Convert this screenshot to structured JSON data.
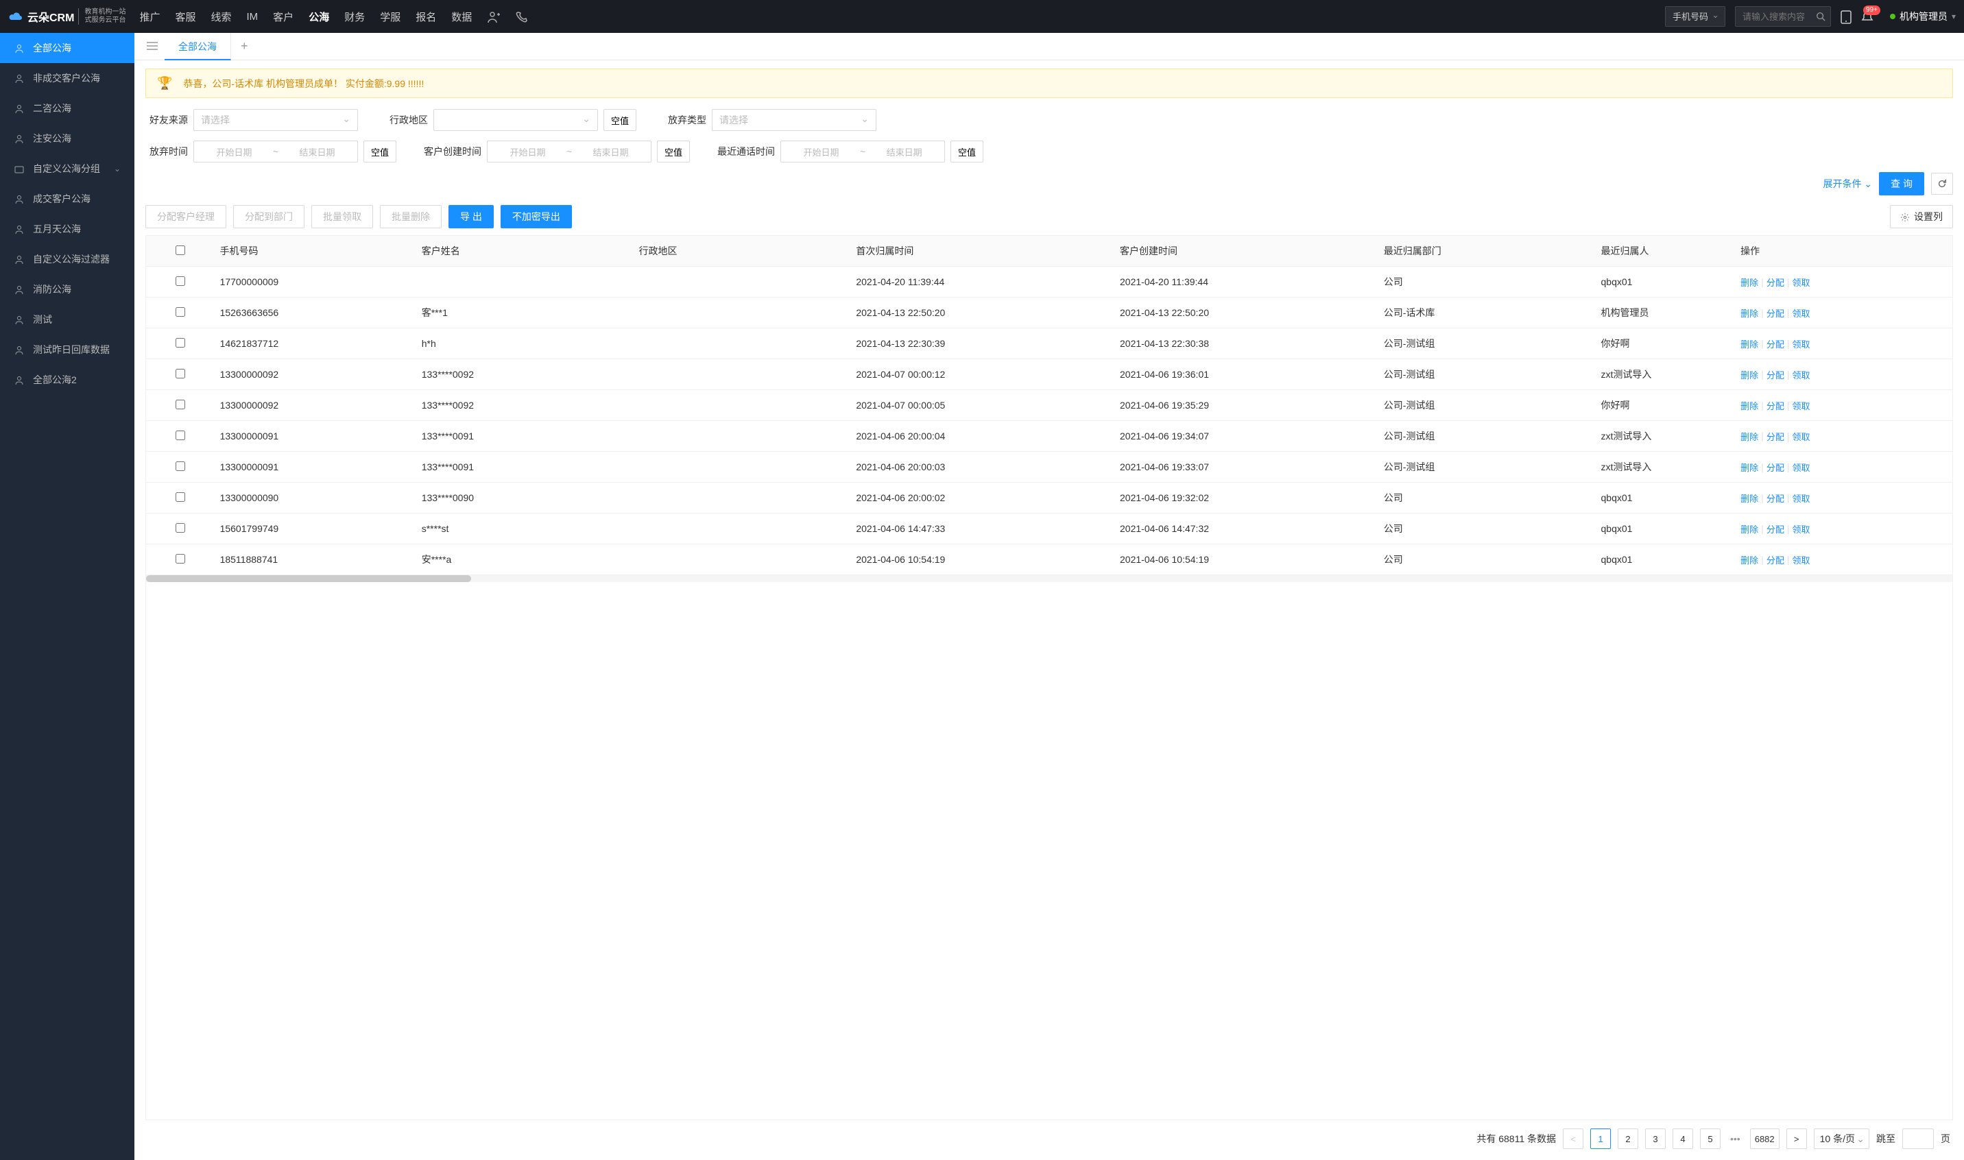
{
  "header": {
    "logo_main": "云朵CRM",
    "logo_sub_line1": "教育机构一站",
    "logo_sub_line2": "式服务云平台",
    "logo_url": "www.yunduocrm.com",
    "nav": [
      "推广",
      "客服",
      "线索",
      "IM",
      "客户",
      "公海",
      "财务",
      "学服",
      "报名",
      "数据"
    ],
    "nav_active_index": 5,
    "search_type": "手机号码",
    "search_placeholder": "请输入搜索内容",
    "badge": "99+",
    "user_name": "机构管理员"
  },
  "sidebar": {
    "items": [
      {
        "label": "全部公海",
        "icon": "users"
      },
      {
        "label": "非成交客户公海",
        "icon": "users"
      },
      {
        "label": "二咨公海",
        "icon": "users"
      },
      {
        "label": "注安公海",
        "icon": "users"
      },
      {
        "label": "自定义公海分组",
        "icon": "folder",
        "expandable": true
      },
      {
        "label": "成交客户公海",
        "icon": "users"
      },
      {
        "label": "五月天公海",
        "icon": "users"
      },
      {
        "label": "自定义公海过滤器",
        "icon": "users"
      },
      {
        "label": "消防公海",
        "icon": "users"
      },
      {
        "label": "测试",
        "icon": "users"
      },
      {
        "label": "测试昨日回库数据",
        "icon": "users"
      },
      {
        "label": "全部公海2",
        "icon": "users"
      }
    ],
    "active_index": 0
  },
  "tabs": {
    "items": [
      "全部公海"
    ],
    "active_index": 0
  },
  "banner": {
    "text": "恭喜，公司-话术库  机构管理员成单！  实付金额:9.99 !!!!!!"
  },
  "filters": {
    "row1": [
      {
        "label": "好友来源",
        "type": "select",
        "placeholder": "请选择"
      },
      {
        "label": "行政地区",
        "type": "select",
        "placeholder": "",
        "clear": "空值"
      },
      {
        "label": "放弃类型",
        "type": "select",
        "placeholder": "请选择"
      }
    ],
    "row2": [
      {
        "label": "放弃时间",
        "type": "daterange",
        "start": "开始日期",
        "end": "结束日期",
        "clear": "空值"
      },
      {
        "label": "客户创建时间",
        "type": "daterange",
        "start": "开始日期",
        "end": "结束日期",
        "clear": "空值"
      },
      {
        "label": "最近通话时间",
        "type": "daterange",
        "start": "开始日期",
        "end": "结束日期",
        "clear": "空值"
      }
    ],
    "expand_label": "展开条件",
    "query_label": "查 询"
  },
  "action_bar": {
    "buttons": [
      {
        "label": "分配客户经理",
        "disabled": true
      },
      {
        "label": "分配到部门",
        "disabled": true
      },
      {
        "label": "批量领取",
        "disabled": true
      },
      {
        "label": "批量删除",
        "disabled": true
      },
      {
        "label": "导 出",
        "primary": true
      },
      {
        "label": "不加密导出",
        "primary": true
      }
    ],
    "settings_label": "设置列"
  },
  "table": {
    "columns": [
      "手机号码",
      "客户姓名",
      "行政地区",
      "首次归属时间",
      "客户创建时间",
      "最近归属部门",
      "最近归属人",
      "操作"
    ],
    "op_labels": {
      "delete": "删除",
      "assign": "分配",
      "claim": "领取"
    },
    "rows": [
      {
        "phone": "17700000009",
        "name": "",
        "region": "",
        "first_time": "2021-04-20 11:39:44",
        "create_time": "2021-04-20 11:39:44",
        "dept": "公司",
        "owner": "qbqx01"
      },
      {
        "phone": "15263663656",
        "name": "客***1",
        "region": "",
        "first_time": "2021-04-13 22:50:20",
        "create_time": "2021-04-13 22:50:20",
        "dept": "公司-话术库",
        "owner": "机构管理员"
      },
      {
        "phone": "14621837712",
        "name": "h*h",
        "region": "",
        "first_time": "2021-04-13 22:30:39",
        "create_time": "2021-04-13 22:30:38",
        "dept": "公司-测试组",
        "owner": "你好啊"
      },
      {
        "phone": "13300000092",
        "name": "133****0092",
        "region": "",
        "first_time": "2021-04-07 00:00:12",
        "create_time": "2021-04-06 19:36:01",
        "dept": "公司-测试组",
        "owner": "zxt测试导入"
      },
      {
        "phone": "13300000092",
        "name": "133****0092",
        "region": "",
        "first_time": "2021-04-07 00:00:05",
        "create_time": "2021-04-06 19:35:29",
        "dept": "公司-测试组",
        "owner": "你好啊"
      },
      {
        "phone": "13300000091",
        "name": "133****0091",
        "region": "",
        "first_time": "2021-04-06 20:00:04",
        "create_time": "2021-04-06 19:34:07",
        "dept": "公司-测试组",
        "owner": "zxt测试导入"
      },
      {
        "phone": "13300000091",
        "name": "133****0091",
        "region": "",
        "first_time": "2021-04-06 20:00:03",
        "create_time": "2021-04-06 19:33:07",
        "dept": "公司-测试组",
        "owner": "zxt测试导入"
      },
      {
        "phone": "13300000090",
        "name": "133****0090",
        "region": "",
        "first_time": "2021-04-06 20:00:02",
        "create_time": "2021-04-06 19:32:02",
        "dept": "公司",
        "owner": "qbqx01"
      },
      {
        "phone": "15601799749",
        "name": "s****st",
        "region": "",
        "first_time": "2021-04-06 14:47:33",
        "create_time": "2021-04-06 14:47:32",
        "dept": "公司",
        "owner": "qbqx01"
      },
      {
        "phone": "18511888741",
        "name": "安****a",
        "region": "",
        "first_time": "2021-04-06 10:54:19",
        "create_time": "2021-04-06 10:54:19",
        "dept": "公司",
        "owner": "qbqx01"
      }
    ]
  },
  "pagination": {
    "total_prefix": "共有",
    "total": "68811",
    "total_suffix": "条数据",
    "pages": [
      "1",
      "2",
      "3",
      "4",
      "5"
    ],
    "last_page": "6882",
    "active_page": "1",
    "page_size_label": "10 条/页",
    "jump_label": "跳至",
    "jump_suffix": "页"
  }
}
